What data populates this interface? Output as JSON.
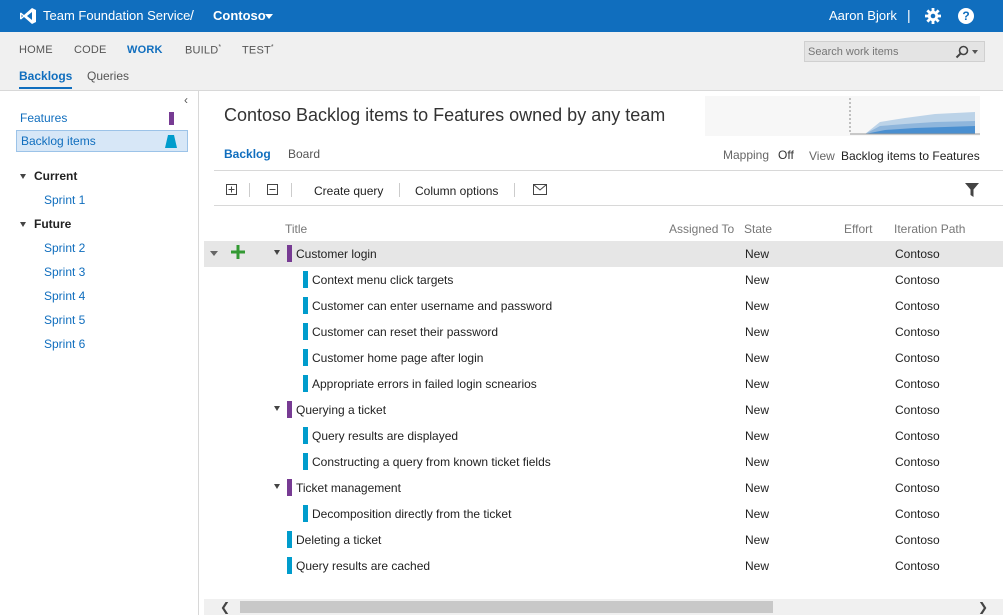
{
  "topbar": {
    "service_name": "Team Foundation Service",
    "separator": "/",
    "project_name": "Contoso",
    "user_name": "Aaron Bjork",
    "user_separator": "|",
    "help_label": "?"
  },
  "hubs": [
    {
      "label": "HOME",
      "star": ""
    },
    {
      "label": "CODE",
      "star": ""
    },
    {
      "label": "WORK",
      "star": ""
    },
    {
      "label": "BUILD",
      "star": "*"
    },
    {
      "label": "TEST",
      "star": "*"
    }
  ],
  "subhubs": [
    {
      "label": "Backlogs"
    },
    {
      "label": "Queries"
    }
  ],
  "search": {
    "placeholder": "Search work items"
  },
  "left_panel": {
    "collapse_glyph": "‹",
    "backlog_levels": [
      {
        "label": "Features",
        "color": "#773b93"
      },
      {
        "label": "Backlog items",
        "color": "#009ccc"
      }
    ],
    "iteration_groups": [
      {
        "label": "Current",
        "sprints": [
          "Sprint 1"
        ]
      },
      {
        "label": "Future",
        "sprints": [
          "Sprint 2",
          "Sprint 3",
          "Sprint 4",
          "Sprint 5",
          "Sprint 6"
        ]
      }
    ]
  },
  "main": {
    "title": "Contoso Backlog items to Features owned by any team",
    "tabs": [
      {
        "label": "Backlog"
      },
      {
        "label": "Board"
      }
    ],
    "mapping_label": "Mapping",
    "mapping_value": "Off",
    "view_label": "View",
    "view_value": "Backlog items to Features"
  },
  "toolbar": {
    "create_query": "Create query",
    "column_options": "Column options"
  },
  "grid": {
    "columns": [
      "Title",
      "Assigned To",
      "State",
      "Effort",
      "Iteration Path"
    ],
    "rows": [
      {
        "title": "Customer login",
        "state": "New",
        "iteration": "Contoso",
        "level": "feature",
        "expandable": true
      },
      {
        "title": "Context menu click targets",
        "state": "New",
        "iteration": "Contoso",
        "level": "child"
      },
      {
        "title": "Customer can enter username and password",
        "state": "New",
        "iteration": "Contoso",
        "level": "child"
      },
      {
        "title": "Customer can reset their password",
        "state": "New",
        "iteration": "Contoso",
        "level": "child"
      },
      {
        "title": "Customer home page after login",
        "state": "New",
        "iteration": "Contoso",
        "level": "child"
      },
      {
        "title": "Appropriate errors in failed login scnearios",
        "state": "New",
        "iteration": "Contoso",
        "level": "child"
      },
      {
        "title": "Querying a ticket",
        "state": "New",
        "iteration": "Contoso",
        "level": "feature",
        "expandable": true
      },
      {
        "title": "Query results are displayed",
        "state": "New",
        "iteration": "Contoso",
        "level": "child"
      },
      {
        "title": "Constructing a query from known ticket fields",
        "state": "New",
        "iteration": "Contoso",
        "level": "child"
      },
      {
        "title": "Ticket management",
        "state": "New",
        "iteration": "Contoso",
        "level": "feature",
        "expandable": true
      },
      {
        "title": "Decomposition directly from the ticket",
        "state": "New",
        "iteration": "Contoso",
        "level": "child"
      },
      {
        "title": "Deleting a ticket",
        "state": "New",
        "iteration": "Contoso",
        "level": "orphan"
      },
      {
        "title": "Query results are cached",
        "state": "New",
        "iteration": "Contoso",
        "level": "orphan"
      }
    ]
  },
  "colors": {
    "accent": "#106ebe",
    "feature_bar": "#773b93",
    "backlog_item_bar": "#009ccc",
    "add_green": "#339933"
  }
}
